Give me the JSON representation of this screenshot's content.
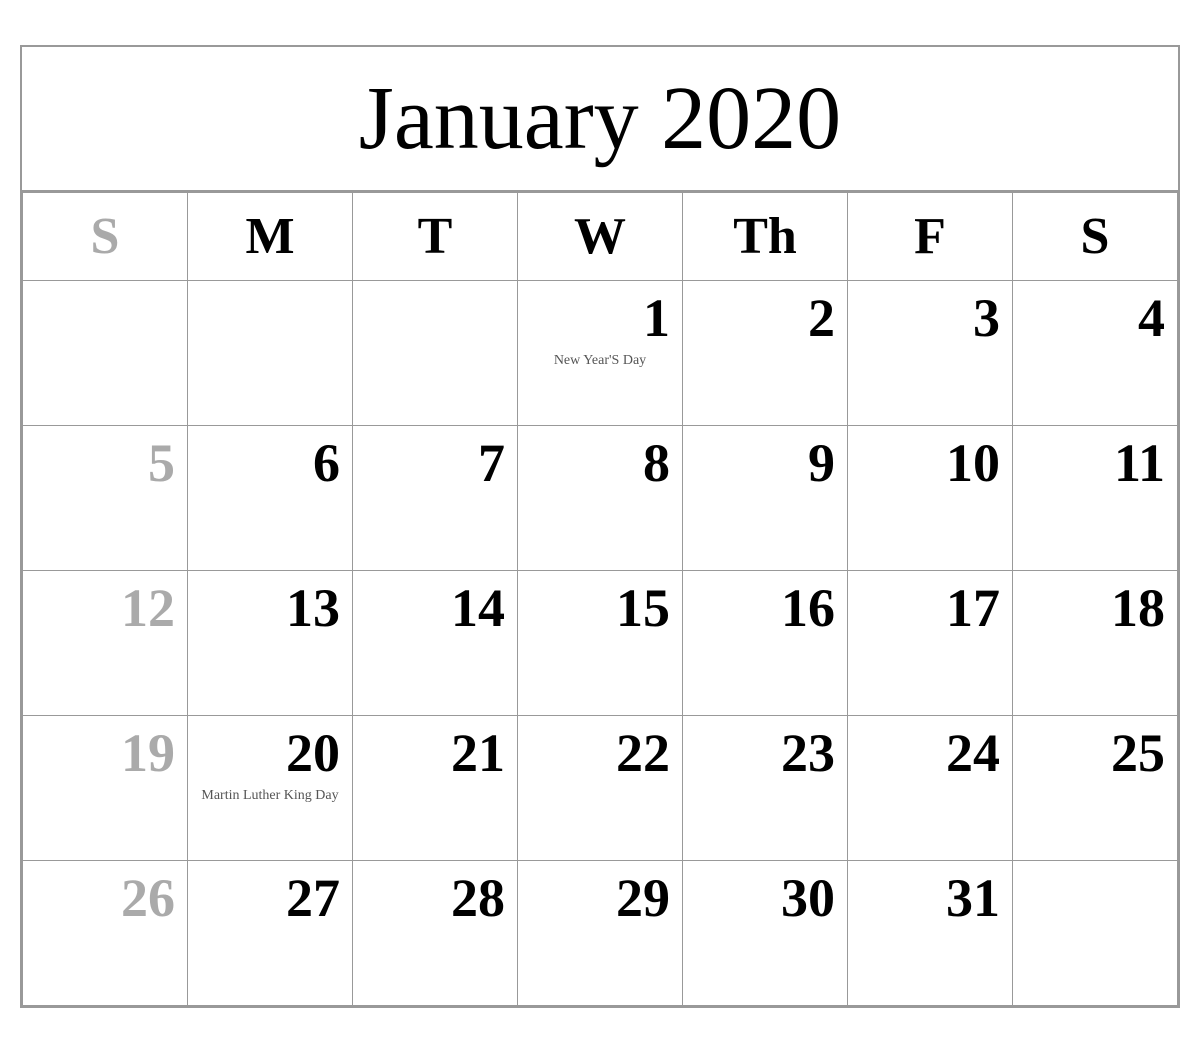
{
  "calendar": {
    "title": "January 2020",
    "headers": [
      {
        "label": "S",
        "type": "sunday"
      },
      {
        "label": "M",
        "type": "weekday"
      },
      {
        "label": "T",
        "type": "weekday"
      },
      {
        "label": "W",
        "type": "weekday"
      },
      {
        "label": "Th",
        "type": "weekday"
      },
      {
        "label": "F",
        "type": "weekday"
      },
      {
        "label": "S",
        "type": "weekday"
      }
    ],
    "weeks": [
      [
        {
          "day": "",
          "type": "empty"
        },
        {
          "day": "",
          "type": "empty"
        },
        {
          "day": "",
          "type": "empty"
        },
        {
          "day": "1",
          "type": "weekday",
          "holiday": "New Year'S Day"
        },
        {
          "day": "2",
          "type": "weekday"
        },
        {
          "day": "3",
          "type": "weekday"
        },
        {
          "day": "4",
          "type": "weekday"
        }
      ],
      [
        {
          "day": "5",
          "type": "sunday"
        },
        {
          "day": "6",
          "type": "weekday"
        },
        {
          "day": "7",
          "type": "weekday"
        },
        {
          "day": "8",
          "type": "weekday"
        },
        {
          "day": "9",
          "type": "weekday"
        },
        {
          "day": "10",
          "type": "weekday"
        },
        {
          "day": "11",
          "type": "weekday"
        }
      ],
      [
        {
          "day": "12",
          "type": "sunday"
        },
        {
          "day": "13",
          "type": "weekday"
        },
        {
          "day": "14",
          "type": "weekday"
        },
        {
          "day": "15",
          "type": "weekday"
        },
        {
          "day": "16",
          "type": "weekday"
        },
        {
          "day": "17",
          "type": "weekday"
        },
        {
          "day": "18",
          "type": "weekday"
        }
      ],
      [
        {
          "day": "19",
          "type": "sunday"
        },
        {
          "day": "20",
          "type": "weekday",
          "holiday": "Martin Luther\nKing Day"
        },
        {
          "day": "21",
          "type": "weekday"
        },
        {
          "day": "22",
          "type": "weekday"
        },
        {
          "day": "23",
          "type": "weekday"
        },
        {
          "day": "24",
          "type": "weekday"
        },
        {
          "day": "25",
          "type": "weekday"
        }
      ],
      [
        {
          "day": "26",
          "type": "sunday"
        },
        {
          "day": "27",
          "type": "weekday"
        },
        {
          "day": "28",
          "type": "weekday"
        },
        {
          "day": "29",
          "type": "weekday"
        },
        {
          "day": "30",
          "type": "weekday"
        },
        {
          "day": "31",
          "type": "weekday"
        },
        {
          "day": "",
          "type": "empty"
        }
      ]
    ]
  }
}
